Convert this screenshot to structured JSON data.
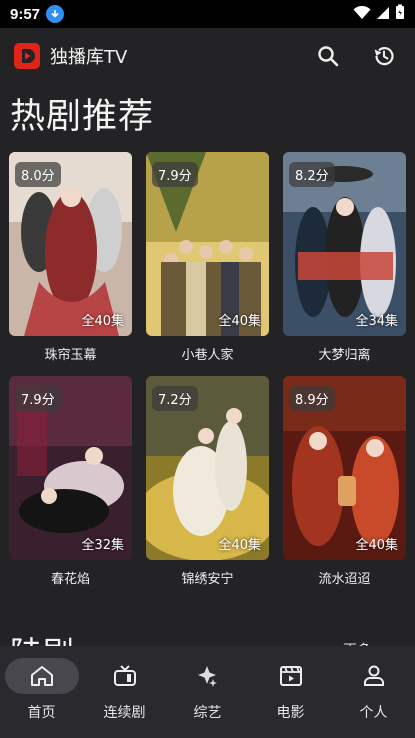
{
  "status_bar": {
    "time": "9:57"
  },
  "app": {
    "title": "独播库TV",
    "brand_color": "#e2231a"
  },
  "section": {
    "title": "热剧推荐"
  },
  "cards": [
    {
      "title": "珠帘玉幕",
      "rating": "8.0分",
      "episodes": "全40集",
      "colors": [
        "#c9b6a8",
        "#8d2b2b",
        "#e6dbd0"
      ]
    },
    {
      "title": "小巷人家",
      "rating": "7.9分",
      "episodes": "全40集",
      "colors": [
        "#b7a24a",
        "#5b6b2e",
        "#e0c873"
      ]
    },
    {
      "title": "大梦归离",
      "rating": "8.2分",
      "episodes": "全34集",
      "colors": [
        "#3b4f66",
        "#1c2a3a",
        "#c9463a"
      ]
    },
    {
      "title": "春花焰",
      "rating": "7.9分",
      "episodes": "全32集",
      "colors": [
        "#3a1f2e",
        "#8a1f3a",
        "#d9c9cf"
      ]
    },
    {
      "title": "锦绣安宁",
      "rating": "7.2分",
      "episodes": "全40集",
      "colors": [
        "#d7b64a",
        "#8a7a2a",
        "#f0eadd"
      ]
    },
    {
      "title": "流水迢迢",
      "rating": "8.9分",
      "episodes": "全40集",
      "colors": [
        "#5a1a12",
        "#a23420",
        "#e0a060"
      ]
    }
  ],
  "next_section": {
    "title": "陆剧",
    "more": "更多"
  },
  "nav": [
    {
      "label": "首页",
      "icon": "home-icon",
      "active": true
    },
    {
      "label": "连续剧",
      "icon": "tv-icon",
      "active": false
    },
    {
      "label": "综艺",
      "icon": "sparkle-icon",
      "active": false
    },
    {
      "label": "电影",
      "icon": "film-icon",
      "active": false
    },
    {
      "label": "个人",
      "icon": "person-icon",
      "active": false
    }
  ]
}
